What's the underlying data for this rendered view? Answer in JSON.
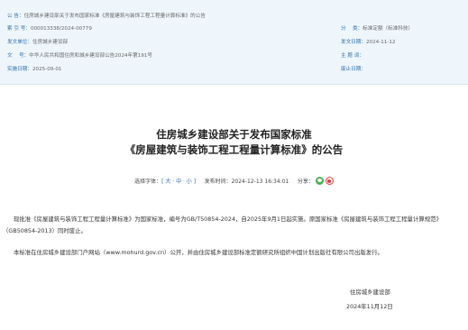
{
  "meta": {
    "breadcrumb_key": "公 告：",
    "breadcrumb_value": "住房城乡建设部关于发布国家标准《房屋建筑与装饰工程工程量计算标准》的公告",
    "rows": [
      {
        "k": "索 引 号：",
        "v": "000013338/2024-00779"
      },
      {
        "k": "分　 类：",
        "v": "标准定额（标准科技）"
      },
      {
        "k": "发文单位：",
        "v": "住房城乡建设部"
      },
      {
        "k": "发文日期：",
        "v": "2024-11-12"
      },
      {
        "k": "文　 号：",
        "v": "中华人民共和国住房和城乡建设部公告2024年第191号"
      },
      {
        "k": "主 题 词：",
        "v": ""
      },
      {
        "k": "实施日期：",
        "v": "2025-09-01"
      },
      {
        "k": "废止日期：",
        "v": ""
      }
    ]
  },
  "title": {
    "line1": "住房城乡建设部关于发布国家标准",
    "line2": "《房屋建筑与装饰工程工程量计算标准》的公告"
  },
  "info": {
    "font_label": "选择字体：",
    "font_options": "[ 大 · 中 · 小 ]",
    "publish_label": "发布时间：",
    "publish_time": "2024-12-13 16:34:01",
    "share_label": "分享：",
    "share_icons": [
      "wechat-icon",
      "weibo-icon"
    ]
  },
  "body": {
    "p1": "现批准《房屋建筑与装饰工程工程量计算标准》为国家标准，编号为GB/T50854-2024，自2025年9月1日起实施。原国家标准《房屋建筑与装饰工程工程量计算规范》（GB50854-2013）同时废止。",
    "p2": "本标准在住房城乡建设部门户网站（www.mohurd.gov.cn）公开，并由住房城乡建设部标准定额研究所组织中国计划出版社有限公司出版发行。"
  },
  "signature": {
    "org": "住房城乡建设部",
    "date": "2024年11月12日"
  }
}
